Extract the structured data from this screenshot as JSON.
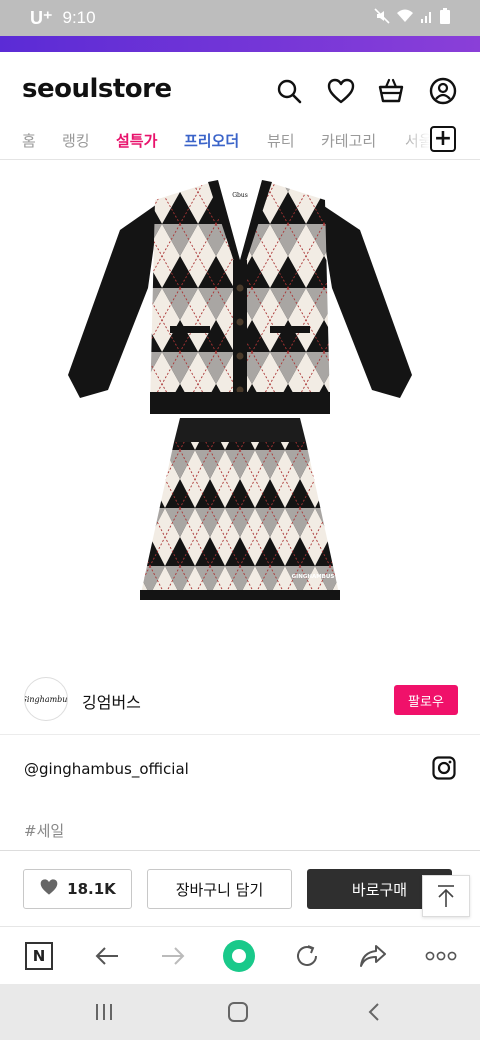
{
  "status_bar": {
    "carrier": "U⁺",
    "time": "9:10",
    "icons": [
      "mute-icon",
      "wifi-icon",
      "signal-icon",
      "battery-icon"
    ]
  },
  "header": {
    "logo": "seoulstore",
    "icons": [
      "search-icon",
      "heart-icon",
      "cart-icon",
      "user-icon"
    ]
  },
  "nav": {
    "tabs": [
      {
        "label": "홈",
        "color": "#9a9a9a"
      },
      {
        "label": "랭킹",
        "color": "#9a9a9a"
      },
      {
        "label": "설특가",
        "color": "#e8126b"
      },
      {
        "label": "프리오더",
        "color": "#3b64c9"
      },
      {
        "label": "뷰티",
        "color": "#9a9a9a"
      },
      {
        "label": "카테고리",
        "color": "#9a9a9a"
      },
      {
        "label": "서울",
        "color": "#9a9a9a"
      }
    ],
    "plus": "+"
  },
  "product": {
    "image_icon": "argyle-knit-cardigan-skirt-set-image",
    "cardigan_tag": "Gbus",
    "skirt_tag": "GINGHAMBUS"
  },
  "brand": {
    "logo_text": "Ginghambus",
    "name": "깅엄버스",
    "follow_label": "팔로우"
  },
  "instagram": {
    "handle": "@ginghambus_official",
    "icon": "instagram-icon"
  },
  "tag": "#세일",
  "actions": {
    "like_count": "18.1K",
    "cart_label": "장바구니 담기",
    "buy_label": "바로구매",
    "top_icon": "scroll-top-icon"
  },
  "browser": {
    "icons": [
      "naver-n-icon",
      "back-arrow-icon",
      "forward-arrow-icon",
      "green-dot-icon",
      "refresh-icon",
      "share-icon",
      "more-icon"
    ],
    "n_label": "N"
  },
  "system_nav": {
    "icons": [
      "recents-icon",
      "home-icon",
      "back-icon"
    ]
  },
  "colors": {
    "accent_strip": "#6a33d8",
    "follow": "#f0116a",
    "buy": "#2f2f2f",
    "green": "#19c98a"
  }
}
